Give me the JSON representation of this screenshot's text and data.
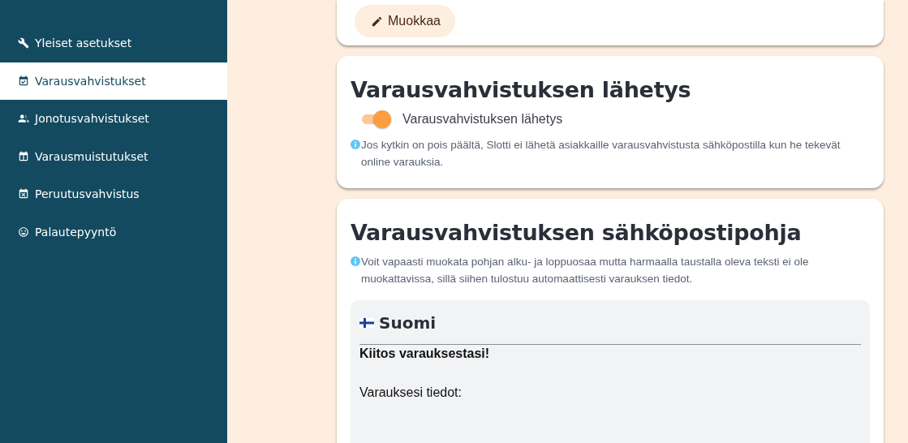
{
  "sidebar": {
    "items": [
      {
        "label": "Yleiset asetukset",
        "selected": false
      },
      {
        "label": "Varausvahvistukset",
        "selected": true
      },
      {
        "label": "Jonotusvahvistukset",
        "selected": false
      },
      {
        "label": "Varausmuistutukset",
        "selected": false
      },
      {
        "label": "Peruutusvahvistus",
        "selected": false
      },
      {
        "label": "Palautepyyntö",
        "selected": false
      }
    ]
  },
  "edit_button": {
    "label": "Muokkaa"
  },
  "sending_card": {
    "title": "Varausvahvistuksen lähetys",
    "toggle": {
      "label": "Varausvahvistuksen lähetys",
      "on": true
    },
    "info": "Jos kytkin on pois päältä, Slotti ei lähetä asiakkaille varausvahvistusta sähköpostilla kun he tekevät online varauksia."
  },
  "template_card": {
    "title": "Varausvahvistuksen sähköpostipohja",
    "info": "Voit vapaasti muokata pohjan alku- ja loppuosaa mutta harmaalla taustalla oleva teksti ei ole muokattavissa, sillä siihen tulostuu automaattisesti varauksen tiedot.",
    "language": "Suomi",
    "greeting": "Kiitos varauksestasi!",
    "details_label": "Varauksesi tiedot:"
  }
}
